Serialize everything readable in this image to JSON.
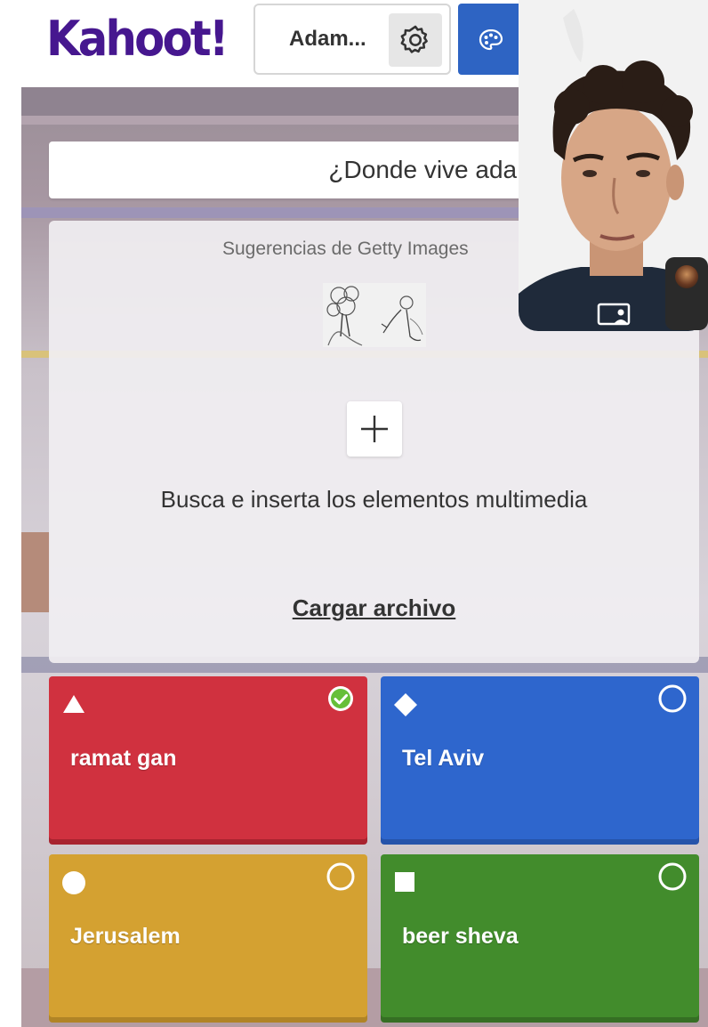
{
  "header": {
    "logo_text": "Kahoot!",
    "player_name": "Adam...",
    "settings_icon": "gear-icon",
    "theme_icon": "palette-icon"
  },
  "question": {
    "text": "¿Donde vive adam?"
  },
  "media": {
    "getty_label": "Sugerencias de Getty Images",
    "add_icon": "plus-icon",
    "hint": "Busca e inserta los elementos multimedia",
    "upload_label": "Cargar archivo"
  },
  "answers": [
    {
      "text": "ramat gan",
      "shape": "triangle",
      "color": "#d0313f",
      "correct": true
    },
    {
      "text": "Tel Aviv",
      "shape": "diamond",
      "color": "#2e66cd",
      "correct": false
    },
    {
      "text": "Jerusalem",
      "shape": "circle",
      "color": "#d4a131",
      "correct": false
    },
    {
      "text": "beer sheva",
      "shape": "square",
      "color": "#428c2c",
      "correct": false
    }
  ],
  "colors": {
    "brand_purple": "#46178f",
    "theme_button": "#2e64c3"
  },
  "video": {
    "pip_icon": "picture-in-picture-icon"
  }
}
